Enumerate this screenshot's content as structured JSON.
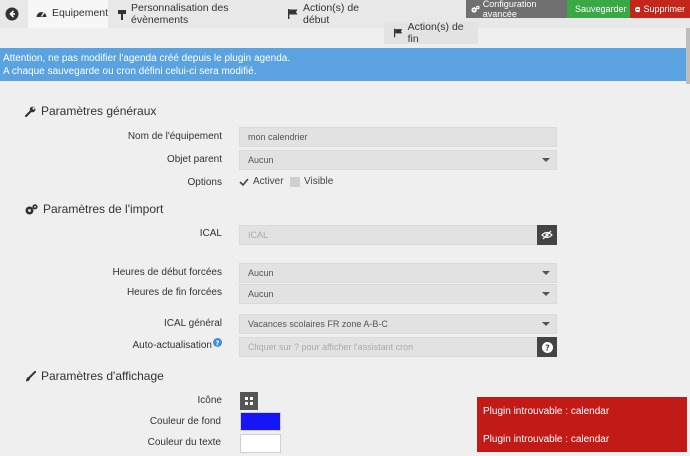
{
  "tabs": {
    "equipement": "Equipement",
    "perso": "Personnalisation des évènements",
    "debut": "Action(s) de début",
    "fin": "Action(s) de fin"
  },
  "buttons": {
    "config": "Configuration avancée",
    "save": "Sauvegarder",
    "delete": "Supprimer"
  },
  "alert": {
    "line1": "Attention, ne pas modifier l'agenda créé depuis le plugin agenda.",
    "line2": "A chaque sauvegarde ou cron défini celui-ci sera modifié."
  },
  "general": {
    "title": "Paramètres généraux",
    "name_label": "Nom de l'équipement",
    "name_value": "mon calendrier",
    "parent_label": "Objet parent",
    "parent_value": "Aucun",
    "options_label": "Options",
    "activate": "Activer",
    "visible": "Visible"
  },
  "import": {
    "title": "Paramètres de l'import",
    "ical_label": "ICAL",
    "ical_placeholder": "ICAL",
    "start_label": "Heures de début forcées",
    "start_value": "Aucun",
    "end_label": "Heures de fin forcées",
    "end_value": "Aucun",
    "general_label": "ICAL général",
    "general_value": "Vacances scolaires FR zone A-B-C",
    "auto_label": "Auto-actualisation",
    "auto_placeholder": "Cliquer sur ? pour afficher l'assistant cron"
  },
  "display": {
    "title": "Paramètres d'affichage",
    "icon_label": "Icône",
    "bg_label": "Couleur de fond",
    "bg_color": "#1515f5",
    "text_label": "Couleur du texte",
    "text_color": "#ffffff"
  },
  "notifications": [
    "Plugin introuvable : calendar",
    "Plugin introuvable : calendar"
  ]
}
